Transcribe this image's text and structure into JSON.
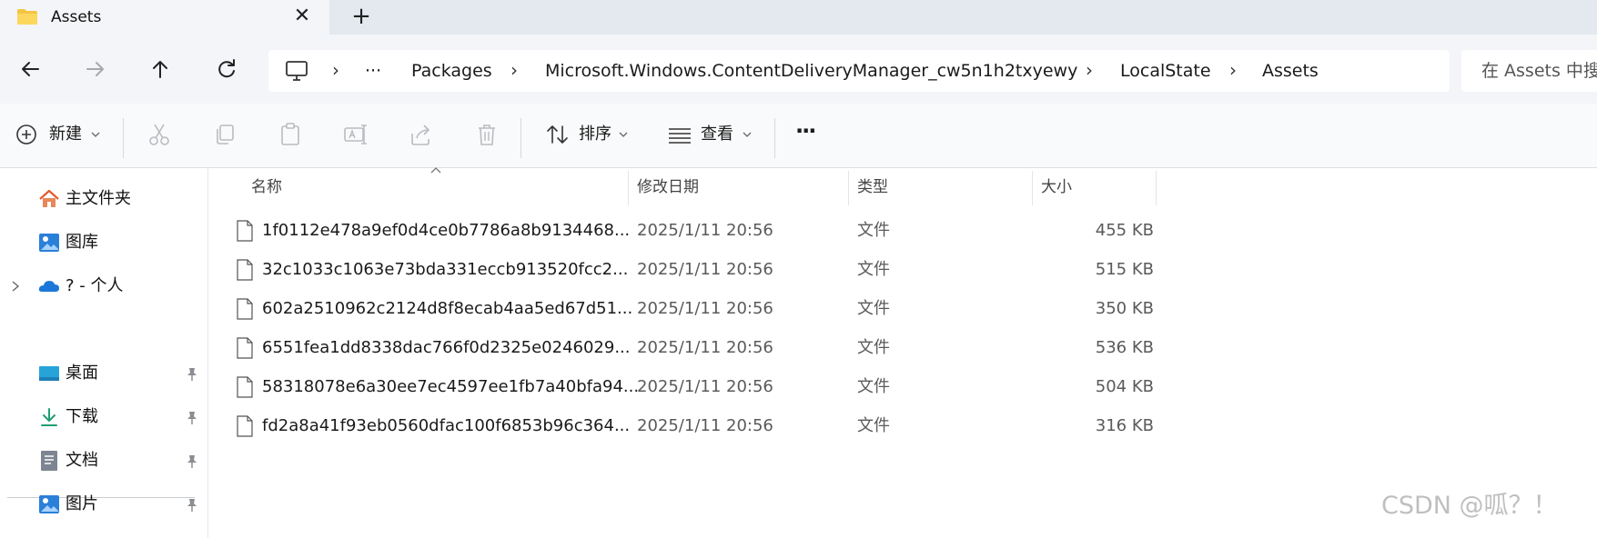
{
  "tab": {
    "title": "Assets",
    "icon": "folder-icon",
    "folder_color": "#f4c542"
  },
  "nav": {
    "back_icon": "arrow-left-icon",
    "forward_icon": "arrow-right-icon",
    "up_icon": "arrow-up-icon",
    "refresh_icon": "refresh-icon"
  },
  "address": {
    "root_icon": "computer-icon",
    "overflow": "···",
    "separator": "›",
    "crumbs": [
      "Packages",
      "Microsoft.Windows.ContentDeliveryManager_cw5n1h2txyewy",
      "LocalState",
      "Assets"
    ]
  },
  "search": {
    "placeholder": "在 Assets 中搜"
  },
  "commands": {
    "new_label": "新建",
    "sort_label": "排序",
    "view_label": "查看",
    "more": "···"
  },
  "navpane": {
    "items": [
      {
        "label": "主文件夹",
        "icon": "home-icon"
      },
      {
        "label": "图库",
        "icon": "gallery-icon"
      },
      {
        "label": "?  - 个人",
        "icon": "onedrive-icon"
      }
    ],
    "quick_access": [
      {
        "label": "桌面",
        "icon": "desktop-icon"
      },
      {
        "label": "下载",
        "icon": "download-icon"
      },
      {
        "label": "文档",
        "icon": "documents-icon"
      },
      {
        "label": "图片",
        "icon": "pictures-icon"
      }
    ]
  },
  "columns": {
    "name": "名称",
    "modified": "修改日期",
    "type": "类型",
    "size": "大小"
  },
  "files": [
    {
      "name": "1f0112e478a9ef0d4ce0b7786a8b9134468...",
      "modified": "2025/1/11 20:56",
      "type": "文件",
      "size": "455 KB"
    },
    {
      "name": "32c1033c1063e73bda331eccb913520fcc2...",
      "modified": "2025/1/11 20:56",
      "type": "文件",
      "size": "515 KB"
    },
    {
      "name": "602a2510962c2124d8f8ecab4aa5ed67d51...",
      "modified": "2025/1/11 20:56",
      "type": "文件",
      "size": "350 KB"
    },
    {
      "name": "6551fea1dd8338dac766f0d2325e0246029...",
      "modified": "2025/1/11 20:56",
      "type": "文件",
      "size": "536 KB"
    },
    {
      "name": "58318078e6a30ee7ec4597ee1fb7a40bfa94...",
      "modified": "2025/1/11 20:56",
      "type": "文件",
      "size": "504 KB"
    },
    {
      "name": "fd2a8a41f93eb0560dfac100f6853b96c364...",
      "modified": "2025/1/11 20:56",
      "type": "文件",
      "size": "316 KB"
    }
  ],
  "watermark": "CSDN @呱？！"
}
